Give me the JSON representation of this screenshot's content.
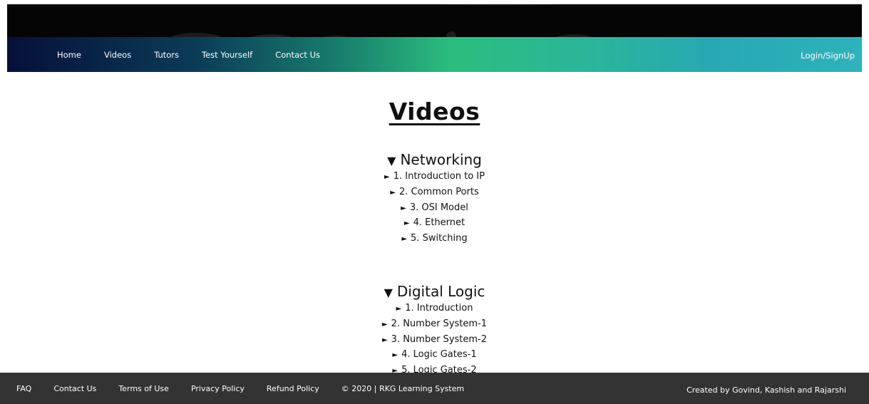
{
  "nav": {
    "links": [
      "Home",
      "Videos",
      "Tutors",
      "Test Yourself",
      "Contact Us"
    ],
    "login": "Login/SignUp"
  },
  "main": {
    "title": "Videos",
    "sections": [
      {
        "heading": "Networking",
        "items": [
          "1. Introduction to IP",
          "2. Common Ports",
          "3. OSI Model",
          "4. Ethernet",
          "5. Switching"
        ]
      },
      {
        "heading": "Digital Logic",
        "items": [
          "1. Introduction",
          "2. Number System-1",
          "3. Number System-2",
          "4. Logic Gates-1",
          "5. Logic Gates-2"
        ]
      }
    ]
  },
  "footer": {
    "links": [
      "FAQ",
      "Contact Us",
      "Terms of Use",
      "Privacy Policy",
      "Refund Policy"
    ],
    "copyright": "© 2020 | RKG Learning System",
    "credit": "Created by Govind, Kashish and Rajarshi"
  },
  "glyphs": {
    "expanded": "▼",
    "collapsed": "►"
  }
}
